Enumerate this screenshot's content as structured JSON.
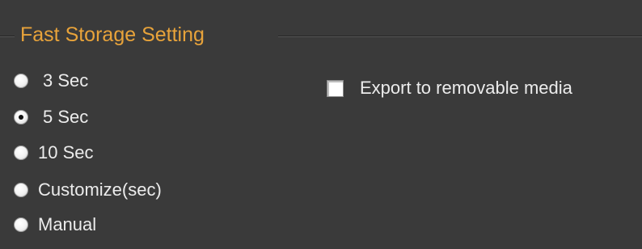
{
  "group": {
    "title": "Fast Storage Setting"
  },
  "storage_options": [
    {
      "label": "3 Sec",
      "checked": false
    },
    {
      "label": "5 Sec",
      "checked": true
    },
    {
      "label": "10 Sec",
      "checked": false
    },
    {
      "label": "Customize(sec)",
      "checked": false
    },
    {
      "label": "Manual",
      "checked": false
    }
  ],
  "export": {
    "label": "Export to removable media",
    "checked": false
  },
  "colors": {
    "background": "#3a3a3a",
    "title": "#e8a33a",
    "text": "#ececec"
  }
}
